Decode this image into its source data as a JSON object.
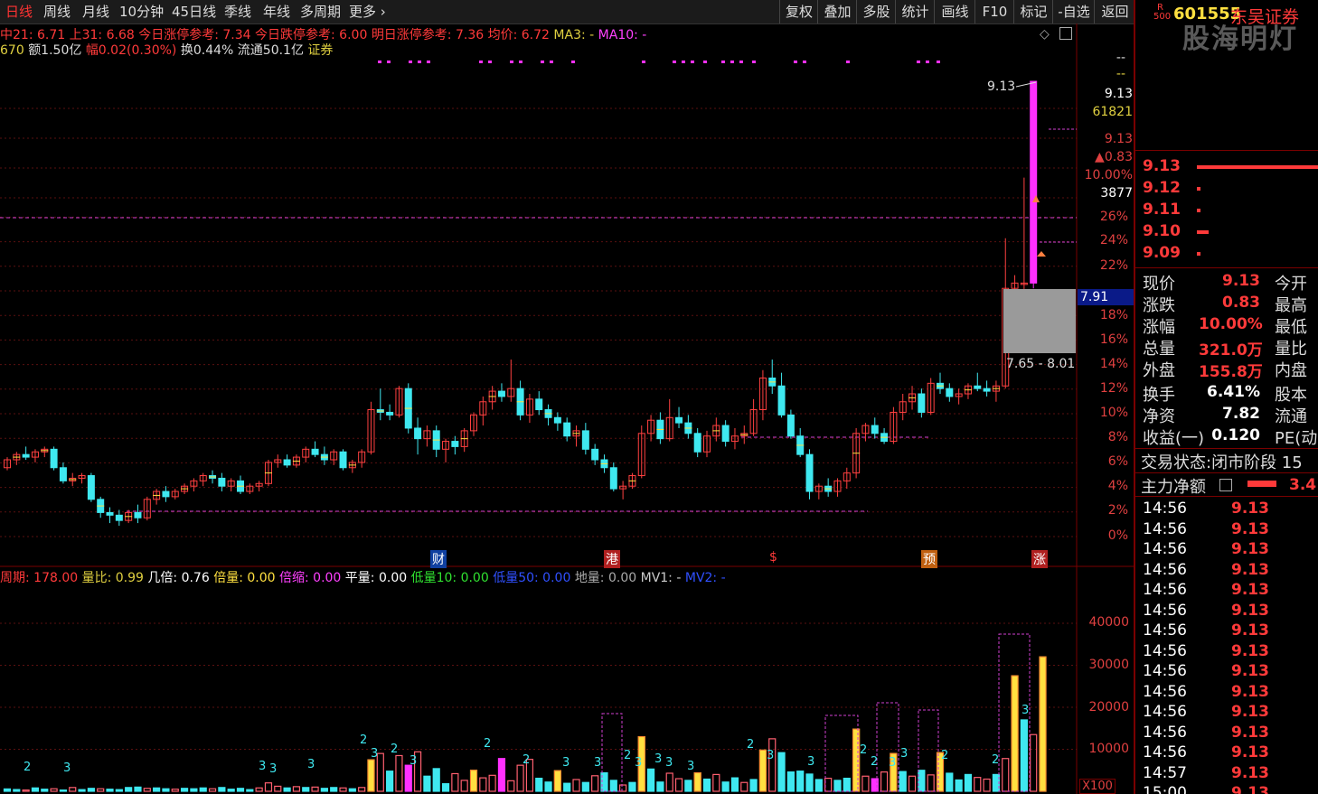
{
  "toolbar": {
    "tabs": [
      "日线",
      "周线",
      "月线",
      "10分钟",
      "45日线",
      "季线",
      "年线",
      "多周期",
      "更多"
    ],
    "buttons": [
      "复权",
      "叠加",
      "多股",
      "统计",
      "画线",
      "F10",
      "标记",
      "-自选",
      "返回"
    ]
  },
  "info_line1": {
    "ma21": "中21: 6.71",
    "ma31": "上31: 6.68",
    "limit_up": "今日涨停参考: 7.34",
    "limit_down": "今日跌停参考: 6.00",
    "tomorrow_limit": "明日涨停参考: 7.36",
    "avg": "均价: 6.72",
    "ma3": "MA3: -",
    "ma10": "MA10: -"
  },
  "info_line2": {
    "vol_prefix": "670",
    "amount": "额1.50亿",
    "amp": "幅0.02(0.30%)",
    "turnover": "换0.44%",
    "float": "流通50.1亿",
    "sector": "证券"
  },
  "price_axis": {
    "labels": [
      "9.13",
      "61821",
      "9.13",
      "▲0.83",
      "10.00%",
      "3877",
      "26%",
      "24%",
      "22%",
      "18%",
      "16%",
      "14%",
      "12%",
      "10%",
      "8%",
      "6%",
      "4%",
      "2%",
      "0%"
    ],
    "top_dashes": [
      "--",
      "--"
    ]
  },
  "price_marker": {
    "value": "7.91"
  },
  "peak_label": "9.13",
  "range_label": "7.65 - 8.01",
  "events": [
    "财",
    "港",
    "$",
    "预",
    "涨"
  ],
  "vol_info": {
    "period": "周期: 178.00",
    "ratio": "量比: 0.99",
    "times": "几倍: 0.76",
    "multiple": "倍量: 0.00",
    "shrink": "倍缩: 0.00",
    "flat": "平量: 0.00",
    "low10": "低量10: 0.00",
    "low50": "低量50: 0.00",
    "ground": "地量: 0.00",
    "mv1": "MV1: -",
    "mv2": "MV2: -"
  },
  "vol_axis": {
    "labels": [
      "40000",
      "30000",
      "20000",
      "10000"
    ],
    "unit": "X100"
  },
  "header": {
    "badge_r": "R",
    "badge_num": "500",
    "code": "601555",
    "name": "东吴证券",
    "watermark": "股海明灯"
  },
  "order_book": [
    {
      "price": "9.13",
      "level": 1.0
    },
    {
      "price": "9.12",
      "level": 0.03
    },
    {
      "price": "9.11",
      "level": 0.03
    },
    {
      "price": "9.10",
      "level": 0.1
    },
    {
      "price": "9.09",
      "level": 0.03
    }
  ],
  "quote": [
    {
      "label": "现价",
      "value": "9.13",
      "label2": "今开"
    },
    {
      "label": "涨跌",
      "value": "0.83",
      "label2": "最高"
    },
    {
      "label": "涨幅",
      "value": "10.00%",
      "label2": "最低"
    },
    {
      "label": "总量",
      "value": "321.0万",
      "label2": "量比"
    },
    {
      "label": "外盘",
      "value": "155.8万",
      "label2": "内盘"
    },
    {
      "label": "换手",
      "value": "6.41%",
      "label2": "股本"
    },
    {
      "label": "净资",
      "value": "7.82",
      "label2": "流通"
    },
    {
      "label": "收益(一)",
      "value": "0.120",
      "label2": "PE(动"
    }
  ],
  "trade_status": "交易状态:闭市阶段 15",
  "main_net": {
    "label": "主力净额",
    "value": "3.4"
  },
  "ticks": [
    {
      "time": "14:56",
      "price": "9.13"
    },
    {
      "time": "14:56",
      "price": "9.13"
    },
    {
      "time": "14:56",
      "price": "9.13"
    },
    {
      "time": "14:56",
      "price": "9.13"
    },
    {
      "time": "14:56",
      "price": "9.13"
    },
    {
      "time": "14:56",
      "price": "9.13"
    },
    {
      "time": "14:56",
      "price": "9.13"
    },
    {
      "time": "14:56",
      "price": "9.13"
    },
    {
      "time": "14:56",
      "price": "9.13"
    },
    {
      "time": "14:56",
      "price": "9.13"
    },
    {
      "time": "14:56",
      "price": "9.13"
    },
    {
      "time": "14:56",
      "price": "9.13"
    },
    {
      "time": "14:56",
      "price": "9.13"
    },
    {
      "time": "14:57",
      "price": "9.13"
    },
    {
      "time": "15:00",
      "price": "9.13"
    }
  ],
  "chart_data": {
    "type": "candlestick",
    "ohlc": [
      [
        6.2,
        6.28,
        6.18,
        6.26
      ],
      [
        6.26,
        6.32,
        6.22,
        6.3
      ],
      [
        6.3,
        6.36,
        6.26,
        6.28
      ],
      [
        6.28,
        6.34,
        6.24,
        6.32
      ],
      [
        6.32,
        6.36,
        6.28,
        6.34
      ],
      [
        6.34,
        6.36,
        6.18,
        6.2
      ],
      [
        6.2,
        6.24,
        6.08,
        6.1
      ],
      [
        6.1,
        6.16,
        6.06,
        6.12
      ],
      [
        6.12,
        6.16,
        6.08,
        6.14
      ],
      [
        6.14,
        6.16,
        5.94,
        5.96
      ],
      [
        5.96,
        5.98,
        5.82,
        5.86
      ],
      [
        5.86,
        5.9,
        5.78,
        5.84
      ],
      [
        5.84,
        5.88,
        5.76,
        5.8
      ],
      [
        5.8,
        5.88,
        5.78,
        5.86
      ],
      [
        5.86,
        5.92,
        5.78,
        5.82
      ],
      [
        5.82,
        5.98,
        5.8,
        5.96
      ],
      [
        5.96,
        6.04,
        5.92,
        6.02
      ],
      [
        6.02,
        6.06,
        5.94,
        5.98
      ],
      [
        5.98,
        6.04,
        5.96,
        6.02
      ],
      [
        6.02,
        6.08,
        6.0,
        6.06
      ],
      [
        6.06,
        6.12,
        6.02,
        6.1
      ],
      [
        6.1,
        6.16,
        6.06,
        6.14
      ],
      [
        6.14,
        6.18,
        6.08,
        6.12
      ],
      [
        6.12,
        6.16,
        6.02,
        6.06
      ],
      [
        6.06,
        6.12,
        6.02,
        6.1
      ],
      [
        6.1,
        6.14,
        6.0,
        6.02
      ],
      [
        6.02,
        6.08,
        6.0,
        6.06
      ],
      [
        6.06,
        6.1,
        6.02,
        6.08
      ],
      [
        6.08,
        6.26,
        6.06,
        6.24
      ],
      [
        6.24,
        6.3,
        6.2,
        6.26
      ],
      [
        6.26,
        6.3,
        6.2,
        6.22
      ],
      [
        6.22,
        6.3,
        6.2,
        6.28
      ],
      [
        6.28,
        6.36,
        6.24,
        6.34
      ],
      [
        6.34,
        6.4,
        6.28,
        6.3
      ],
      [
        6.3,
        6.36,
        6.22,
        6.26
      ],
      [
        6.26,
        6.34,
        6.22,
        6.32
      ],
      [
        6.32,
        6.34,
        6.18,
        6.2
      ],
      [
        6.2,
        6.26,
        6.16,
        6.24
      ],
      [
        6.24,
        6.34,
        6.2,
        6.32
      ],
      [
        6.32,
        6.7,
        6.3,
        6.64
      ],
      [
        6.64,
        6.8,
        6.56,
        6.62
      ],
      [
        6.62,
        6.68,
        6.56,
        6.6
      ],
      [
        6.6,
        6.82,
        6.58,
        6.8
      ],
      [
        6.8,
        6.84,
        6.46,
        6.5
      ],
      [
        6.5,
        6.58,
        6.3,
        6.42
      ],
      [
        6.42,
        6.52,
        6.36,
        6.48
      ],
      [
        6.48,
        6.52,
        6.28,
        6.34
      ],
      [
        6.34,
        6.42,
        6.24,
        6.4
      ],
      [
        6.4,
        6.44,
        6.3,
        6.36
      ],
      [
        6.36,
        6.5,
        6.32,
        6.48
      ],
      [
        6.48,
        6.62,
        6.44,
        6.6
      ],
      [
        6.6,
        6.74,
        6.52,
        6.7
      ],
      [
        6.7,
        6.82,
        6.64,
        6.78
      ],
      [
        6.78,
        6.84,
        6.7,
        6.74
      ],
      [
        6.74,
        7.02,
        6.7,
        6.8
      ],
      [
        6.8,
        6.86,
        6.56,
        6.6
      ],
      [
        6.6,
        6.76,
        6.54,
        6.72
      ],
      [
        6.72,
        6.78,
        6.6,
        6.64
      ],
      [
        6.64,
        6.68,
        6.52,
        6.58
      ],
      [
        6.58,
        6.62,
        6.48,
        6.54
      ],
      [
        6.54,
        6.58,
        6.4,
        6.44
      ],
      [
        6.44,
        6.52,
        6.36,
        6.48
      ],
      [
        6.48,
        6.54,
        6.3,
        6.34
      ],
      [
        6.34,
        6.38,
        6.22,
        6.26
      ],
      [
        6.26,
        6.3,
        6.16,
        6.2
      ],
      [
        6.2,
        6.24,
        6.02,
        6.04
      ],
      [
        6.04,
        6.1,
        5.96,
        6.06
      ],
      [
        6.06,
        6.16,
        6.04,
        6.14
      ],
      [
        6.14,
        6.52,
        6.12,
        6.46
      ],
      [
        6.46,
        6.6,
        6.4,
        6.56
      ],
      [
        6.56,
        6.62,
        6.38,
        6.42
      ],
      [
        6.42,
        6.72,
        6.4,
        6.58
      ],
      [
        6.58,
        6.66,
        6.5,
        6.54
      ],
      [
        6.54,
        6.6,
        6.42,
        6.46
      ],
      [
        6.46,
        6.5,
        6.28,
        6.32
      ],
      [
        6.32,
        6.48,
        6.28,
        6.44
      ],
      [
        6.44,
        6.58,
        6.4,
        6.52
      ],
      [
        6.52,
        6.56,
        6.36,
        6.4
      ],
      [
        6.4,
        6.5,
        6.34,
        6.44
      ],
      [
        6.44,
        6.52,
        6.38,
        6.46
      ],
      [
        6.46,
        6.72,
        6.44,
        6.64
      ],
      [
        6.64,
        6.94,
        6.56,
        6.88
      ],
      [
        6.88,
        7.02,
        6.76,
        6.82
      ],
      [
        6.82,
        6.92,
        6.58,
        6.6
      ],
      [
        6.6,
        6.64,
        6.42,
        6.44
      ],
      [
        6.44,
        6.5,
        6.28,
        6.3
      ],
      [
        6.3,
        6.34,
        5.96,
        6.02
      ],
      [
        6.02,
        6.08,
        5.96,
        6.06
      ],
      [
        6.06,
        6.12,
        5.98,
        6.02
      ],
      [
        6.02,
        6.12,
        5.98,
        6.1
      ],
      [
        6.1,
        6.2,
        6.04,
        6.16
      ],
      [
        6.16,
        6.5,
        6.12,
        6.46
      ],
      [
        6.46,
        6.54,
        6.4,
        6.52
      ],
      [
        6.52,
        6.58,
        6.42,
        6.46
      ],
      [
        6.46,
        6.5,
        6.38,
        6.4
      ],
      [
        6.4,
        6.66,
        6.38,
        6.62
      ],
      [
        6.62,
        6.76,
        6.56,
        6.7
      ],
      [
        6.7,
        6.82,
        6.64,
        6.76
      ],
      [
        6.76,
        6.8,
        6.58,
        6.62
      ],
      [
        6.62,
        6.88,
        6.6,
        6.84
      ],
      [
        6.84,
        6.92,
        6.76,
        6.8
      ],
      [
        6.8,
        6.84,
        6.7,
        6.74
      ],
      [
        6.74,
        6.8,
        6.68,
        6.76
      ],
      [
        6.76,
        6.84,
        6.72,
        6.82
      ],
      [
        6.82,
        6.92,
        6.78,
        6.8
      ],
      [
        6.8,
        6.86,
        6.74,
        6.78
      ],
      [
        6.78,
        6.86,
        6.7,
        6.82
      ],
      [
        6.82,
        7.94,
        6.8,
        7.56
      ],
      [
        7.56,
        7.66,
        7.42,
        7.6
      ],
      [
        7.6,
        8.4,
        7.46,
        7.6
      ],
      [
        7.6,
        9.13,
        7.56,
        9.13
      ]
    ],
    "volume": [
      [
        560,
        "cyan"
      ],
      [
        420,
        "cyan"
      ],
      [
        300,
        "red"
      ],
      [
        800,
        "cyan"
      ],
      [
        500,
        "cyan"
      ],
      [
        600,
        "red"
      ],
      [
        300,
        "cyan"
      ],
      [
        900,
        "red"
      ],
      [
        400,
        "cyan"
      ],
      [
        700,
        "cyan"
      ],
      [
        600,
        "red"
      ],
      [
        500,
        "cyan"
      ],
      [
        400,
        "cyan"
      ],
      [
        900,
        "cyan"
      ],
      [
        1000,
        "cyan"
      ],
      [
        700,
        "red"
      ],
      [
        800,
        "cyan"
      ],
      [
        600,
        "cyan"
      ],
      [
        500,
        "red"
      ],
      [
        700,
        "cyan"
      ],
      [
        600,
        "cyan"
      ],
      [
        800,
        "cyan"
      ],
      [
        600,
        "red"
      ],
      [
        900,
        "cyan"
      ],
      [
        500,
        "cyan"
      ],
      [
        700,
        "cyan"
      ],
      [
        400,
        "cyan"
      ],
      [
        800,
        "red"
      ],
      [
        2000,
        "red"
      ],
      [
        1200,
        "red"
      ],
      [
        800,
        "cyan"
      ],
      [
        1100,
        "red"
      ],
      [
        900,
        "cyan"
      ],
      [
        1000,
        "red"
      ],
      [
        700,
        "cyan"
      ],
      [
        900,
        "cyan"
      ],
      [
        800,
        "red"
      ],
      [
        600,
        "cyan"
      ],
      [
        900,
        "red"
      ],
      [
        7500,
        "yellow"
      ],
      [
        9000,
        "red"
      ],
      [
        4800,
        "cyan"
      ],
      [
        8500,
        "red"
      ],
      [
        6200,
        "magenta"
      ],
      [
        9400,
        "red"
      ],
      [
        3600,
        "cyan"
      ],
      [
        5400,
        "cyan"
      ],
      [
        1800,
        "cyan"
      ],
      [
        4200,
        "red"
      ],
      [
        2600,
        "red"
      ],
      [
        5000,
        "yellow"
      ],
      [
        3200,
        "red"
      ],
      [
        3800,
        "red"
      ],
      [
        7800,
        "magenta"
      ],
      [
        2500,
        "red"
      ],
      [
        6200,
        "red"
      ],
      [
        7600,
        "red"
      ],
      [
        3100,
        "cyan"
      ],
      [
        2200,
        "cyan"
      ],
      [
        4900,
        "yellow"
      ],
      [
        1900,
        "cyan"
      ],
      [
        2800,
        "red"
      ],
      [
        2100,
        "cyan"
      ],
      [
        3700,
        "red"
      ],
      [
        4400,
        "cyan"
      ],
      [
        2600,
        "cyan"
      ],
      [
        1500,
        "red"
      ],
      [
        2100,
        "cyan"
      ],
      [
        13000,
        "yellow"
      ],
      [
        5300,
        "cyan"
      ],
      [
        2200,
        "cyan"
      ],
      [
        4300,
        "red"
      ],
      [
        3000,
        "red"
      ],
      [
        2600,
        "cyan"
      ],
      [
        4400,
        "yellow"
      ],
      [
        2900,
        "cyan"
      ],
      [
        4000,
        "red"
      ],
      [
        2200,
        "cyan"
      ],
      [
        3200,
        "cyan"
      ],
      [
        2100,
        "red"
      ],
      [
        2800,
        "cyan"
      ],
      [
        9800,
        "yellow"
      ],
      [
        12500,
        "red"
      ],
      [
        9200,
        "cyan"
      ],
      [
        4600,
        "cyan"
      ],
      [
        4800,
        "cyan"
      ],
      [
        4100,
        "cyan"
      ],
      [
        2800,
        "cyan"
      ],
      [
        3100,
        "red"
      ],
      [
        2600,
        "cyan"
      ],
      [
        3100,
        "cyan"
      ],
      [
        14800,
        "yellow"
      ],
      [
        3600,
        "red"
      ],
      [
        3000,
        "magenta"
      ],
      [
        4600,
        "red"
      ],
      [
        9000,
        "yellow"
      ],
      [
        4700,
        "cyan"
      ],
      [
        3600,
        "red"
      ],
      [
        5000,
        "cyan"
      ],
      [
        3900,
        "red"
      ],
      [
        9200,
        "yellow"
      ],
      [
        4300,
        "cyan"
      ],
      [
        2700,
        "cyan"
      ],
      [
        4000,
        "cyan"
      ],
      [
        3300,
        "red"
      ],
      [
        2900,
        "red"
      ],
      [
        4000,
        "cyan"
      ],
      [
        7800,
        "red"
      ],
      [
        27500,
        "yellow"
      ],
      [
        17000,
        "cyan"
      ],
      [
        13500,
        "red"
      ],
      [
        32000,
        "yellow"
      ]
    ]
  }
}
